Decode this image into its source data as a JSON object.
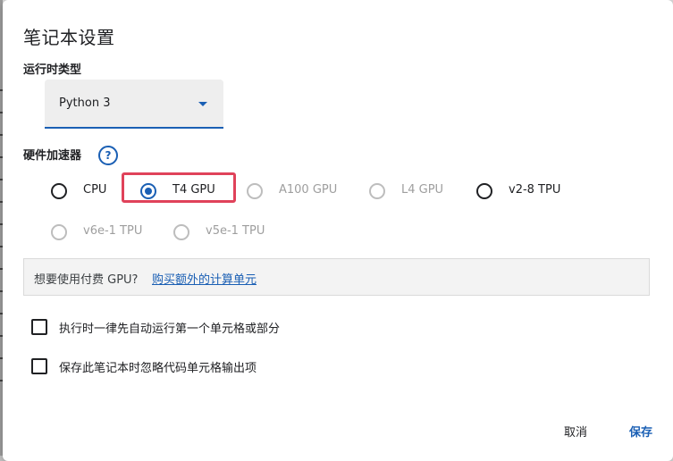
{
  "dialog": {
    "title": "笔记本设置",
    "runtime": {
      "label": "运行时类型",
      "selected": "Python 3"
    },
    "accelerator": {
      "label": "硬件加速器",
      "help_icon": "question-circle-icon",
      "options": [
        {
          "label": "CPU",
          "state": "enabled"
        },
        {
          "label": "T4 GPU",
          "state": "selected"
        },
        {
          "label": "A100 GPU",
          "state": "disabled"
        },
        {
          "label": "L4 GPU",
          "state": "disabled"
        },
        {
          "label": "v2-8 TPU",
          "state": "enabled"
        },
        {
          "label": "v6e-1 TPU",
          "state": "disabled"
        },
        {
          "label": "v5e-1 TPU",
          "state": "disabled"
        }
      ]
    },
    "gpu_info": {
      "question": "想要使用付费 GPU?",
      "link": "购买额外的计算单元"
    },
    "checkboxes": [
      {
        "label": "执行时一律先自动运行第一个单元格或部分",
        "checked": false
      },
      {
        "label": "保存此笔记本时忽略代码单元格输出项",
        "checked": false
      }
    ],
    "buttons": {
      "cancel": "取消",
      "save": "保存"
    }
  },
  "colors": {
    "accent": "#1a5fb4",
    "highlight": "#e0425a",
    "disabled": "#9e9e9e"
  }
}
